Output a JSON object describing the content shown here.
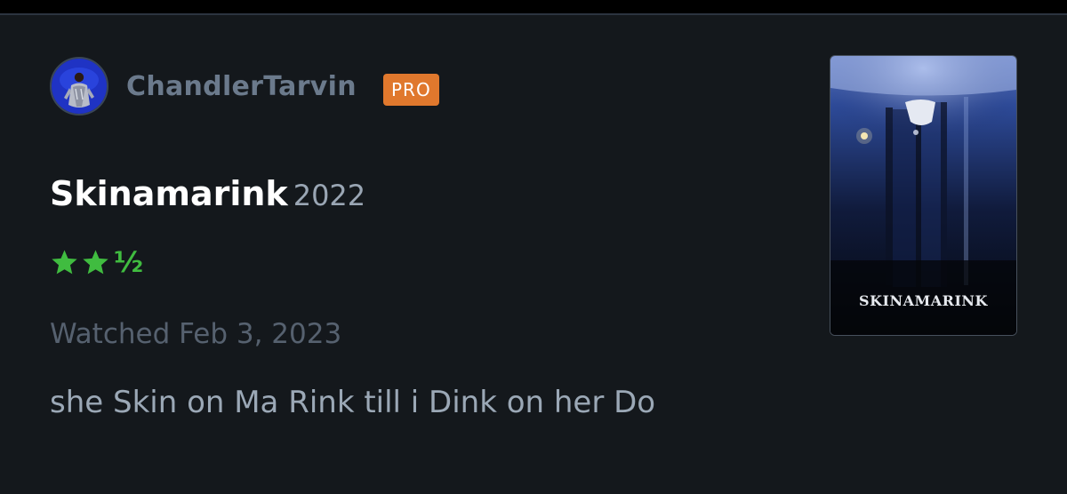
{
  "review": {
    "author": {
      "username": "ChandlerTarvin",
      "badge": "PRO",
      "avatar_icon": "user-avatar-photo"
    },
    "film": {
      "title": "Skinamarink",
      "year": "2022",
      "poster_title": "SKINAMARINK"
    },
    "rating": {
      "stars": 2.5,
      "max_stars": 5,
      "full_star_icon": "star-icon",
      "half_label": "½"
    },
    "watched_label": "Watched Feb 3, 2023",
    "body": "she Skin on Ma Rink till i Dink on her Do"
  },
  "colors": {
    "background": "#14181c",
    "username": "#6b7a8c",
    "badge_bg": "#e0782d",
    "title": "#ffffff",
    "year": "#9aa6b4",
    "star": "#40bc40",
    "watched": "#56616f",
    "body": "#9ba8b6"
  }
}
